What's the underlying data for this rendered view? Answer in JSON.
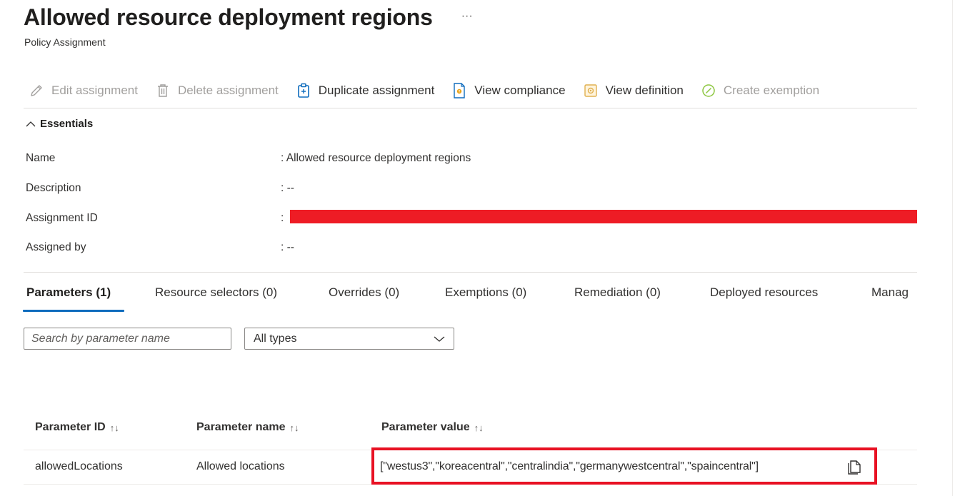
{
  "header": {
    "title": "Allowed resource deployment regions",
    "more_label": "···",
    "subtitle": "Policy Assignment"
  },
  "toolbar": {
    "edit": "Edit assignment",
    "delete": "Delete assignment",
    "duplicate": "Duplicate assignment",
    "view_compliance": "View compliance",
    "view_definition": "View definition",
    "create_exemption": "Create exemption"
  },
  "essentials": {
    "toggle_label": "Essentials",
    "rows": [
      {
        "label": "Name",
        "value": ": Allowed resource deployment regions"
      },
      {
        "label": "Description",
        "value": ": --"
      },
      {
        "label": "Assignment ID",
        "value": ":"
      },
      {
        "label": "Assigned by",
        "value": ": --"
      }
    ]
  },
  "tabs": [
    {
      "label": "Parameters (1)",
      "active": true
    },
    {
      "label": "Resource selectors (0)"
    },
    {
      "label": "Overrides (0)"
    },
    {
      "label": "Exemptions (0)"
    },
    {
      "label": "Remediation (0)"
    },
    {
      "label": "Deployed resources"
    },
    {
      "label": "Manag"
    }
  ],
  "filters": {
    "search_placeholder": "Search by parameter name",
    "type_selected": "All types"
  },
  "table": {
    "columns": [
      "Parameter ID",
      "Parameter name",
      "Parameter value"
    ],
    "sort_glyph": "↑↓",
    "rows": [
      {
        "id": "allowedLocations",
        "name": "Allowed locations",
        "value": "[\"westus3\",\"koreacentral\",\"centralindia\",\"germanywestcentral\",\"spaincentral\"]"
      }
    ]
  },
  "colors": {
    "accent": "#0f6cbd",
    "redaction": "#ee1c25",
    "highlight_border": "#e81123"
  }
}
